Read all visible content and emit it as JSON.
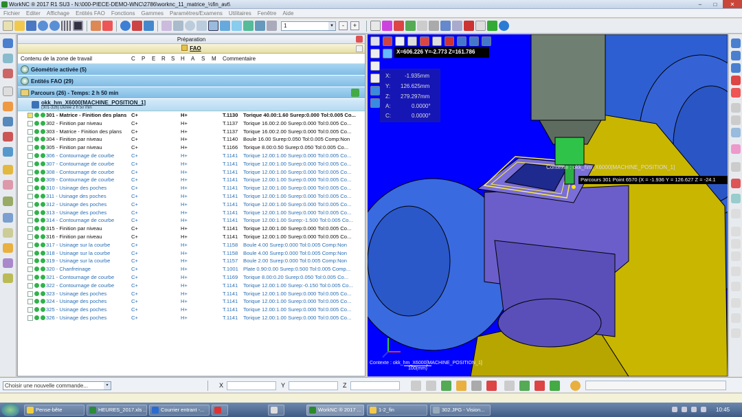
{
  "window": {
    "title": "WorkNC ® 2017 R1 SU3 - N:\\000-PIECE-DEMO-WNC\\2786\\worknc_11_matrice_½fin_avt\\",
    "controls": [
      "–",
      "□",
      "✕"
    ]
  },
  "menu": [
    "Fichier",
    "Editer",
    "Affichage",
    "Entités FAO",
    "Fonctions",
    "Gammes",
    "Paramètres/Examens",
    "Utilitaires",
    "Fenêtre",
    "Aide"
  ],
  "toolbar": {
    "combo_value": "1",
    "minus": "-",
    "plus": "+"
  },
  "panel": {
    "header": "Préparation",
    "fao": "FAO",
    "columns": {
      "contents": "Contenu de la zone de travail",
      "c": "C",
      "p": "P",
      "e": "E",
      "r": "R",
      "s": "S",
      "h": "H",
      "a": "A",
      "s2": "S",
      "m": "M",
      "comment": "Commentaire"
    },
    "sections": {
      "geometry": "Géométrie activée (5)",
      "entities": "Entités FAO (29)",
      "toolpaths": "Parcours (26) - Temps: 2 h 50 min"
    },
    "machine": {
      "name": "okk_hm_X6000[MACHINE_POSITION_1]",
      "sub": "(301-326) Durée 2 h 50 min"
    },
    "rows": [
      {
        "name": "301 - Matrice - Finition des plans",
        "c": "C+",
        "h": "H+",
        "tool": "T.1130",
        "info": "Torique 40.00:1.60  Surep:0.000  Tol:0.005  Co...",
        "style": "sel"
      },
      {
        "name": "302 - Finition par niveau",
        "c": "C+",
        "h": "H+",
        "tool": "T.1137",
        "info": "Torique 16.00:2.00  Surep:0.000  Tol:0.005  Co...",
        "style": "blk"
      },
      {
        "name": "303 - Matrice - Finition des plans",
        "c": "C+",
        "h": "H+",
        "tool": "T.1137",
        "info": "Torique 16.00:2.00  Surep:0.000  Tol:0.005  Co...",
        "style": "blk"
      },
      {
        "name": "304 - Finition par niveau",
        "c": "C+",
        "h": "H+",
        "tool": "T.1140",
        "info": "Boule 16.00  Surep:0.050  Tol:0.005  Comp:Non",
        "style": "blk"
      },
      {
        "name": "305 - Finition par niveau",
        "c": "C+",
        "h": "H+",
        "tool": "T.1166",
        "info": "Torique 8.00:0.50  Surep:0.050  Tol:0.005  Co...",
        "style": "blk"
      },
      {
        "name": "306 - Contournage de courbe",
        "c": "C+",
        "h": "H+",
        "tool": "T.1141",
        "info": "Torique 12.00:1.00  Surep:0.000  Tol:0.005  Co...",
        "style": "blue"
      },
      {
        "name": "307 - Contournage de courbe",
        "c": "C+",
        "h": "H+",
        "tool": "T.1141",
        "info": "Torique 12.00:1.00  Surep:0.000  Tol:0.005  Co...",
        "style": "blue"
      },
      {
        "name": "308 - Contournage de courbe",
        "c": "C+",
        "h": "H+",
        "tool": "T.1141",
        "info": "Torique 12.00:1.00  Surep:0.000  Tol:0.005  Co...",
        "style": "blue"
      },
      {
        "name": "309 - Contournage de courbe",
        "c": "C+",
        "h": "H+",
        "tool": "T.1141",
        "info": "Torique 12.00:1.00  Surep:0.000  Tol:0.005  Co...",
        "style": "blue"
      },
      {
        "name": "310 - Usinage des poches",
        "c": "C+",
        "h": "H+",
        "tool": "T.1141",
        "info": "Torique 12.00:1.00  Surep:0.000  Tol:0.005  Co...",
        "style": "blue"
      },
      {
        "name": "311 - Usinage des poches",
        "c": "C+",
        "h": "H+",
        "tool": "T.1141",
        "info": "Torique 12.00:1.00  Surep:0.000  Tol:0.005  Co...",
        "style": "blue"
      },
      {
        "name": "312 - Usinage des poches",
        "c": "C+",
        "h": "H+",
        "tool": "T.1141",
        "info": "Torique 12.00:1.00  Surep:0.000  Tol:0.005  Co...",
        "style": "blue"
      },
      {
        "name": "313 - Usinage des poches",
        "c": "C+",
        "h": "H+",
        "tool": "T.1141",
        "info": "Torique 12.00:1.00  Surep:0.000  Tol:0.005  Co...",
        "style": "blue"
      },
      {
        "name": "314 - Contournage de courbe",
        "c": "C+",
        "h": "H+",
        "tool": "T.1141",
        "info": "Torique 12.00:1.00  Surep:-1.500  Tol:0.005  Co...",
        "style": "blue"
      },
      {
        "name": "315 - Finition par niveau",
        "c": "C+",
        "h": "H+",
        "tool": "T.1141",
        "info": "Torique 12.00:1.00  Surep:0.000  Tol:0.005  Co...",
        "style": "blk"
      },
      {
        "name": "316 - Finition par niveau",
        "c": "C+",
        "h": "H+",
        "tool": "T.1141",
        "info": "Torique 12.00:1.00  Surep:0.000  Tol:0.005  Co...",
        "style": "blk"
      },
      {
        "name": "317 - Usinage sur la courbe",
        "c": "C+",
        "h": "H+",
        "tool": "T.1158",
        "info": "Boule 4.00  Surep:0.000  Tol:0.005  Comp:Non",
        "style": "blue"
      },
      {
        "name": "318 - Usinage sur la courbe",
        "c": "C+",
        "h": "H+",
        "tool": "T.1158",
        "info": "Boule 4.00  Surep:0.000  Tol:0.005  Comp:Non",
        "style": "blue"
      },
      {
        "name": "319 - Usinage sur la courbe",
        "c": "C+",
        "h": "H+",
        "tool": "T.1157",
        "info": "Boule 2.00  Surep:0.000  Tol:0.005  Comp:Non",
        "style": "blue"
      },
      {
        "name": "320 - Chanfreinage",
        "c": "C+",
        "h": "H+",
        "tool": "T.1001",
        "info": "Plate 0.90:0.00  Surep:0.500  Tol:0.005  Comp...",
        "style": "blue"
      },
      {
        "name": "321 - Contournage de courbe",
        "c": "C+",
        "h": "H+",
        "tool": "T.1169",
        "info": "Torique 8.00:0.20  Surep:0.050  Tol:0.005  Co...",
        "style": "blue"
      },
      {
        "name": "322 - Contournage de courbe",
        "c": "C+",
        "h": "H+",
        "tool": "T.1141",
        "info": "Torique 12.00:1.00  Surep:-0.150  Tol:0.005  Co...",
        "style": "blue"
      },
      {
        "name": "323 - Usinage des poches",
        "c": "C+",
        "h": "H+",
        "tool": "T.1141",
        "info": "Torique 12.00:1.00  Surep:0.000  Tol:0.005  Co...",
        "style": "blue"
      },
      {
        "name": "324 - Usinage des poches",
        "c": "C+",
        "h": "H+",
        "tool": "T.1141",
        "info": "Torique 12.00:1.00  Surep:0.000  Tol:0.005  Co...",
        "style": "blue"
      },
      {
        "name": "325 - Usinage des poches",
        "c": "C+",
        "h": "H+",
        "tool": "T.1141",
        "info": "Torique 12.00:1.00  Surep:0.000  Tol:0.005  Co...",
        "style": "blue"
      },
      {
        "name": "326 - Usinage des poches",
        "c": "C+",
        "h": "H+",
        "tool": "T.1141",
        "info": "Torique 12.00:1.00  Surep:0.000  Tol:0.005  Co...",
        "style": "blue"
      }
    ]
  },
  "viewport": {
    "coords": "X=606.226  Y=-2.773  Z=161.786",
    "readout": {
      "x_label": "X:",
      "x_val": "-1.935mm",
      "y_label": "Y:",
      "y_val": "126.625mm",
      "z_label": "Z:",
      "z_val": "279.297mm",
      "a_label": "A:",
      "a_val": "0.0000°",
      "c_label": "C:",
      "c_val": "0.0000°"
    },
    "context_top": "Contexte : okk_hm_X6000[MACHINE_POSITION_1]",
    "tooltip": "Parcours 301 Point 6570 (X = -1.936  Y = 126.627  Z = -24.1",
    "context_bottom": "Contexte : okk_hm_X6000[MACHINE_POSITION_1]",
    "scale": "100(mm)"
  },
  "command": {
    "placeholder": "Choisir une nouvelle commande...",
    "x": "X",
    "y": "Y",
    "z": "Z"
  },
  "taskbar": {
    "items": [
      "Pense-bête",
      "HEURES_2017.xls ...",
      "Courrier entrant -...",
      "",
      "",
      "WorkNC ® 2017 ...",
      "1-2_fin",
      "302.JPG - Vision..."
    ],
    "clock": "10:45"
  },
  "colors": {
    "viewport_bg": "#0000ff",
    "machine_blue": "#2a5fcf",
    "table_purple": "#6a5cc8",
    "frame_yellow": "#c8b400",
    "spindle_green": "#2ec44a"
  }
}
